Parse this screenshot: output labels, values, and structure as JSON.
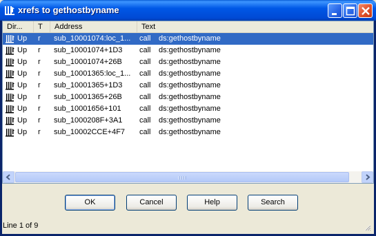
{
  "window": {
    "title": "xrefs to gethostbyname"
  },
  "columns": [
    "Dir...",
    "T",
    "Address",
    "Text"
  ],
  "rows": [
    {
      "dir": "Up",
      "type": "r",
      "address": "sub_10001074:loc_1...",
      "mnemonic": "call",
      "operand": "ds:gethostbyname",
      "selected": true
    },
    {
      "dir": "Up",
      "type": "r",
      "address": "sub_10001074+1D3",
      "mnemonic": "call",
      "operand": "ds:gethostbyname",
      "selected": false
    },
    {
      "dir": "Up",
      "type": "r",
      "address": "sub_10001074+26B",
      "mnemonic": "call",
      "operand": "ds:gethostbyname",
      "selected": false
    },
    {
      "dir": "Up",
      "type": "r",
      "address": "sub_10001365:loc_1...",
      "mnemonic": "call",
      "operand": "ds:gethostbyname",
      "selected": false
    },
    {
      "dir": "Up",
      "type": "r",
      "address": "sub_10001365+1D3",
      "mnemonic": "call",
      "operand": "ds:gethostbyname",
      "selected": false
    },
    {
      "dir": "Up",
      "type": "r",
      "address": "sub_10001365+26B",
      "mnemonic": "call",
      "operand": "ds:gethostbyname",
      "selected": false
    },
    {
      "dir": "Up",
      "type": "r",
      "address": "sub_10001656+101",
      "mnemonic": "call",
      "operand": "ds:gethostbyname",
      "selected": false
    },
    {
      "dir": "Up",
      "type": "r",
      "address": "sub_1000208F+3A1",
      "mnemonic": "call",
      "operand": "ds:gethostbyname",
      "selected": false
    },
    {
      "dir": "Up",
      "type": "r",
      "address": "sub_10002CCE+4F7",
      "mnemonic": "call",
      "operand": "ds:gethostbyname",
      "selected": false
    }
  ],
  "buttons": {
    "ok": "OK",
    "cancel": "Cancel",
    "help": "Help",
    "search": "Search"
  },
  "status": "Line 1 of 9",
  "colors": {
    "selection": "#316ac5",
    "titlebar": "#0058e6",
    "dialog_bg": "#ece9d8"
  }
}
